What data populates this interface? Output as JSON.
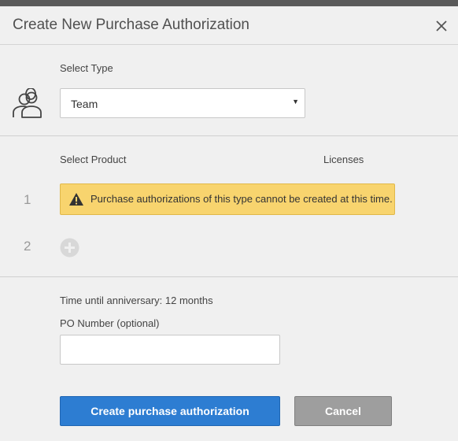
{
  "dialog": {
    "title": "Create New Purchase Authorization"
  },
  "type_section": {
    "label": "Select Type",
    "selected": "Team",
    "icon": "people-icon"
  },
  "product_section": {
    "select_product_label": "Select Product",
    "licenses_label": "Licenses",
    "rows": [
      {
        "number": "1",
        "warning": "Purchase authorizations of this type cannot be created at this time."
      },
      {
        "number": "2",
        "icon": "add-circle-icon"
      }
    ]
  },
  "details": {
    "anniversary_text": "Time until anniversary: 12 months",
    "po_label": "PO Number (optional)",
    "po_value": "",
    "po_placeholder": ""
  },
  "actions": {
    "create_label": "Create purchase authorization",
    "cancel_label": "Cancel"
  },
  "colors": {
    "primary": "#2d7dd2",
    "warning_bg": "#f8d46e",
    "cancel_bg": "#9e9e9e"
  }
}
